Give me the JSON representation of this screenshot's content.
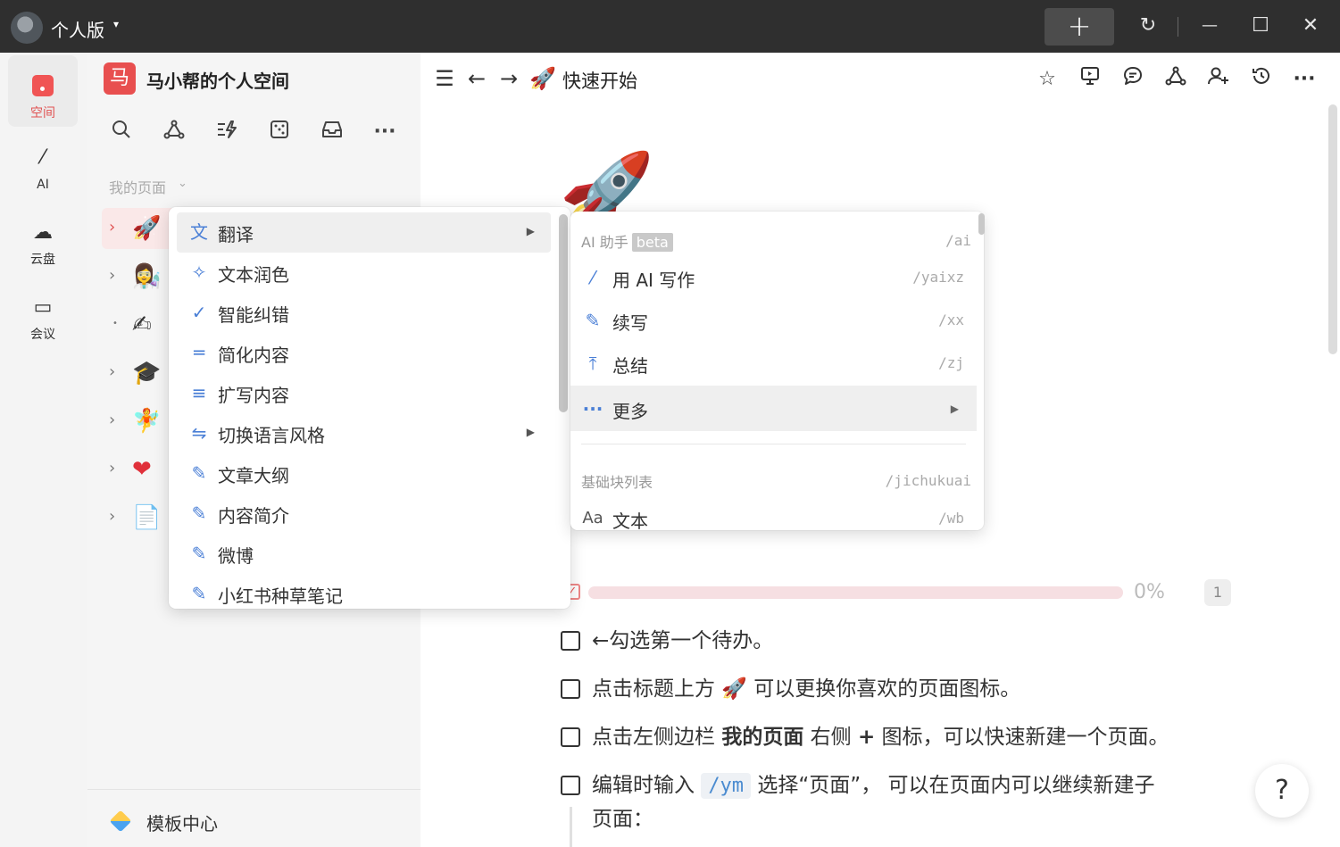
{
  "titlebar": {
    "edition_label": "个人版",
    "caret": "▾",
    "new_button": "+",
    "sync_icon": "↻",
    "minimize_icon": "—",
    "maximize_icon": "☐",
    "close_icon": "✕"
  },
  "rail": {
    "items": [
      {
        "label": "空间",
        "icon": "space-icon",
        "active": true
      },
      {
        "label": "AI",
        "icon": "ai-wand-icon",
        "glyph": "⁄"
      },
      {
        "label": "云盘",
        "icon": "cloud-icon",
        "glyph": "☁"
      },
      {
        "label": "会议",
        "icon": "video-icon",
        "glyph": "▭"
      }
    ]
  },
  "sidebar": {
    "badge": "马",
    "workspace_name": "马小帮的个人空间",
    "section_title": "我的页面",
    "section_caret": "⌄",
    "tree": [
      {
        "emoji": "🚀",
        "active": true
      },
      {
        "emoji": "👩‍🔬"
      },
      {
        "emoji": "✍"
      },
      {
        "emoji": "🎓"
      },
      {
        "emoji": "🧚"
      },
      {
        "emoji": "❤"
      },
      {
        "emoji": "📄"
      }
    ],
    "footer_label": "模板中心"
  },
  "header": {
    "page_emoji": "🚀",
    "page_title": "快速开始"
  },
  "content": {
    "page_icon": "🚀",
    "progress": {
      "percent_label": "0%",
      "value": 0,
      "count": "1"
    },
    "todos": [
      {
        "text": "←勾选第一个待办。"
      },
      {
        "text_a": "点击标题上方 ",
        "emoji": "🚀",
        "text_b": " 可以更换你喜欢的页面图标。"
      },
      {
        "text_a": "点击左侧边栏 ",
        "bold": "我的页面",
        "text_b": " 右侧 ",
        "plus": "+",
        "text_c": " 图标，可以快速新建一个页面。"
      },
      {
        "text_a": "编辑时输入 ",
        "code": "/ym",
        "text_b": " 选择“页面”， 可以在页面内可以继续新建子",
        "text_c": "页面："
      }
    ],
    "help_label": "?"
  },
  "menu_primary": {
    "items": [
      {
        "label": "翻译",
        "icon": "translate-icon",
        "glyph": "文",
        "submenu": true,
        "hover": true
      },
      {
        "label": "文本润色",
        "icon": "sparkle-wand-icon",
        "glyph": "✧"
      },
      {
        "label": "智能纠错",
        "icon": "check-icon",
        "glyph": "✓"
      },
      {
        "label": "简化内容",
        "icon": "lines-short-icon",
        "glyph": "═"
      },
      {
        "label": "扩写内容",
        "icon": "lines-long-icon",
        "glyph": "≡"
      },
      {
        "label": "切换语言风格",
        "icon": "swap-icon",
        "glyph": "⇋",
        "submenu": true
      },
      {
        "label": "文章大纲",
        "icon": "pencil-icon",
        "glyph": "✎"
      },
      {
        "label": "内容简介",
        "icon": "pencil-icon",
        "glyph": "✎"
      },
      {
        "label": "微博",
        "icon": "pencil-icon",
        "glyph": "✎"
      },
      {
        "label": "小红书种草笔记",
        "icon": "pencil-icon",
        "glyph": "✎"
      }
    ],
    "submenu_arrow": "▶"
  },
  "menu_secondary": {
    "ai_header": "AI 助手",
    "beta_badge": "beta",
    "ai_header_key": "/ai",
    "items": [
      {
        "label": "用 AI 写作",
        "key": "/yaixz",
        "icon": "ai-wand-icon",
        "glyph": "⁄"
      },
      {
        "label": "续写",
        "key": "/xx",
        "icon": "pencil-icon",
        "glyph": "✎"
      },
      {
        "label": "总结",
        "key": "/zj",
        "icon": "summary-icon",
        "glyph": "⤒"
      },
      {
        "label": "更多",
        "icon": "more-icon",
        "glyph": "···",
        "submenu": true,
        "hover": true
      }
    ],
    "basic_header": "基础块列表",
    "basic_header_key": "/jichukuai",
    "basic_items": [
      {
        "label": "文本",
        "key": "/wb",
        "icon": "text-icon",
        "glyph": "Aa"
      }
    ],
    "submenu_arrow": "▶"
  },
  "colors": {
    "accent": "#e05252",
    "titlebar": "#2f2f2f",
    "menu_icon": "#4a7fd6",
    "progress_track": "#f6dfe2"
  }
}
